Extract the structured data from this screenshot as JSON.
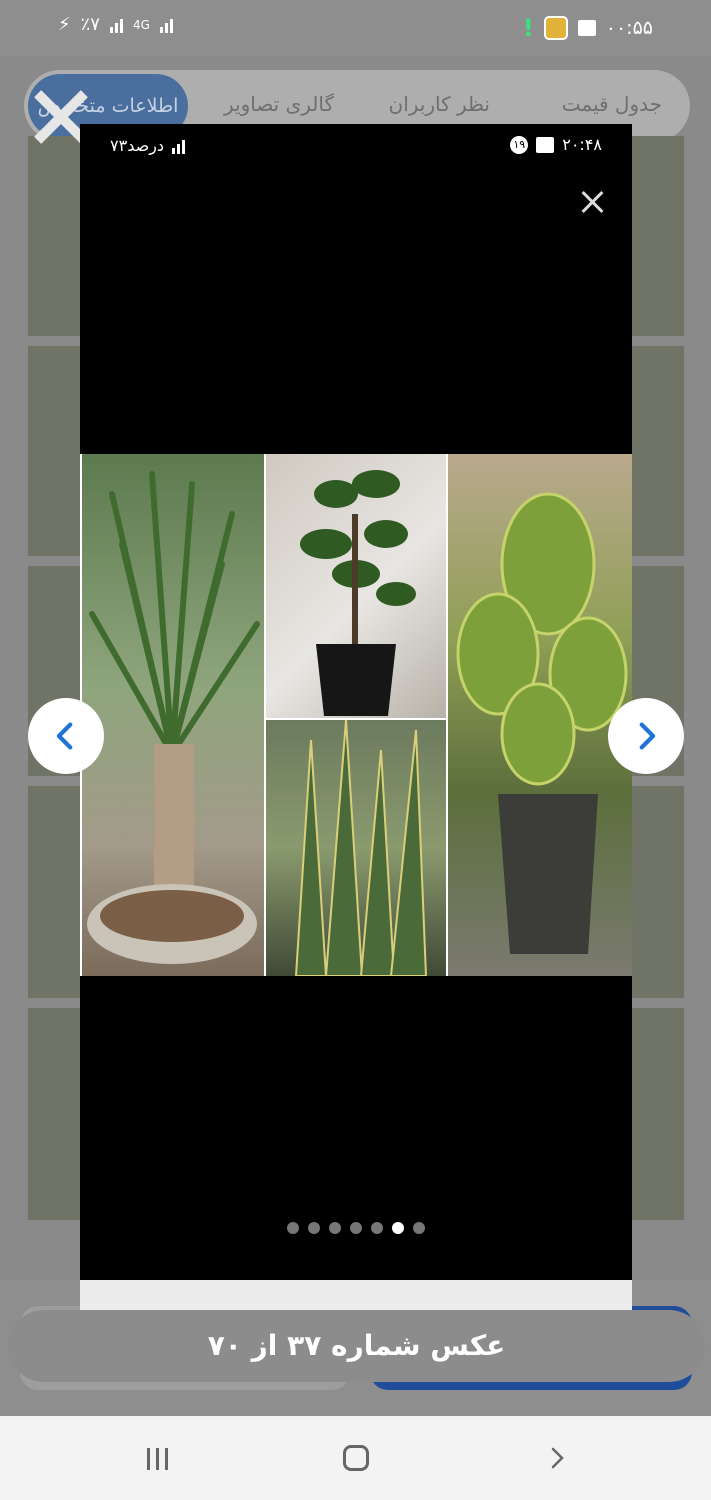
{
  "status_bar": {
    "battery_label": "٪۷",
    "network_label": "4G",
    "time": "۰۰:۵۵"
  },
  "tabs": [
    {
      "label": "جدول قیمت"
    },
    {
      "label": "نظر کاربران"
    },
    {
      "label": "گالری تصاویر"
    },
    {
      "label": "اطلاعات متخصص"
    }
  ],
  "viewer": {
    "inner_status": {
      "time": "۲۰:۴۸",
      "badge": "۱۹",
      "battery": "۷۳درصد"
    },
    "photo_alt": "",
    "page_dots": {
      "total": 7,
      "active_index": 5
    }
  },
  "toast": {
    "text": "عکس شماره ۳۷ از ۷۰"
  },
  "colors": {
    "accent_blue": "#1f4d9a",
    "tab_active": "#4a6f9e",
    "nav_arrow": "#1f73d6"
  },
  "icons": {
    "close": "close-icon",
    "prev": "chevron-left-icon",
    "next": "chevron-right-icon"
  }
}
